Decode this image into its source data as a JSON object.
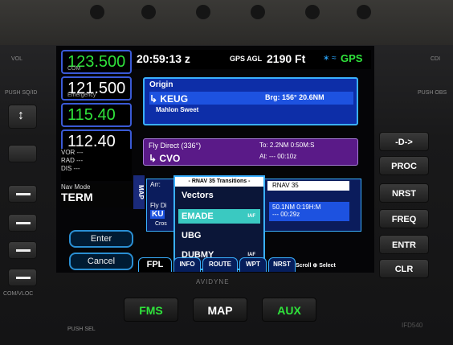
{
  "device": {
    "left_knob_labels": [
      "VOL",
      "PUSH SQ/ID",
      "COM/VLOC",
      "PUSH SEL"
    ],
    "right_knob_labels": [
      "CDI",
      "PUSH OBS"
    ],
    "logo": "AVIDYNE",
    "model": "IFD540"
  },
  "com_nav": {
    "freqs": [
      {
        "value": "123.500",
        "sub": "COM",
        "color": "#2fe33b"
      },
      {
        "value": "121.500",
        "sub": "Emergency",
        "color": "#ffffff"
      },
      {
        "value": "115.40",
        "sub": "",
        "color": "#2fe33b"
      },
      {
        "value": "112.40",
        "sub": "",
        "color": "#ffffff"
      }
    ],
    "vor": "VOR ---",
    "rad": "RAD ---",
    "dis": "DIS ---"
  },
  "navmode": {
    "label": "Nav Mode",
    "value": "TERM"
  },
  "map_tab": "MAP",
  "soft_buttons": {
    "enter": "Enter",
    "cancel": "Cancel"
  },
  "status": {
    "time": "20:59:13 z",
    "gps_agl_label": "GPS AGL",
    "gps_agl_value": "2190 Ft",
    "bt_wifi": "∗ ≈",
    "gps": "GPS"
  },
  "origin": {
    "title": "Origin",
    "waypoint": "↳ KEUG",
    "brg": "Brg: 156°   20.6NM",
    "sub": "Mahlon Sweet"
  },
  "fly_direct": {
    "title": "Fly Direct (336°)",
    "waypoint": "↳ CVO",
    "to": "To:  2.2NM   0:50M:S",
    "at": "At:   ---     00:10z"
  },
  "procedure": {
    "arr": "Arr:",
    "rnav": "RNAV 35",
    "fly_di": "Fly Di",
    "ku": "KU",
    "cros": "Cros",
    "dist_line1": "50.1NM  0:19H:M",
    "dist_line2": "---     00:29z"
  },
  "dropdown": {
    "header": "- RNAV 35 Transitions -",
    "items": [
      {
        "label": "Vectors",
        "iaf": ""
      },
      {
        "label": "EMADE",
        "iaf": "IAF"
      },
      {
        "label": "UBG",
        "iaf": ""
      },
      {
        "label": "DUBMY",
        "iaf": "IAF"
      }
    ],
    "selected_index": 1
  },
  "tabs": [
    "FPL",
    "INFO",
    "ROUTE",
    "WPT",
    "NRST"
  ],
  "scroll_select": "Scroll ⊕ Select",
  "right_buttons": [
    "-D->",
    "PROC",
    "NRST",
    "FREQ",
    "ENTR",
    "CLR"
  ],
  "bottom_buttons": {
    "fms": "FMS",
    "map": "MAP",
    "aux": "AUX"
  }
}
